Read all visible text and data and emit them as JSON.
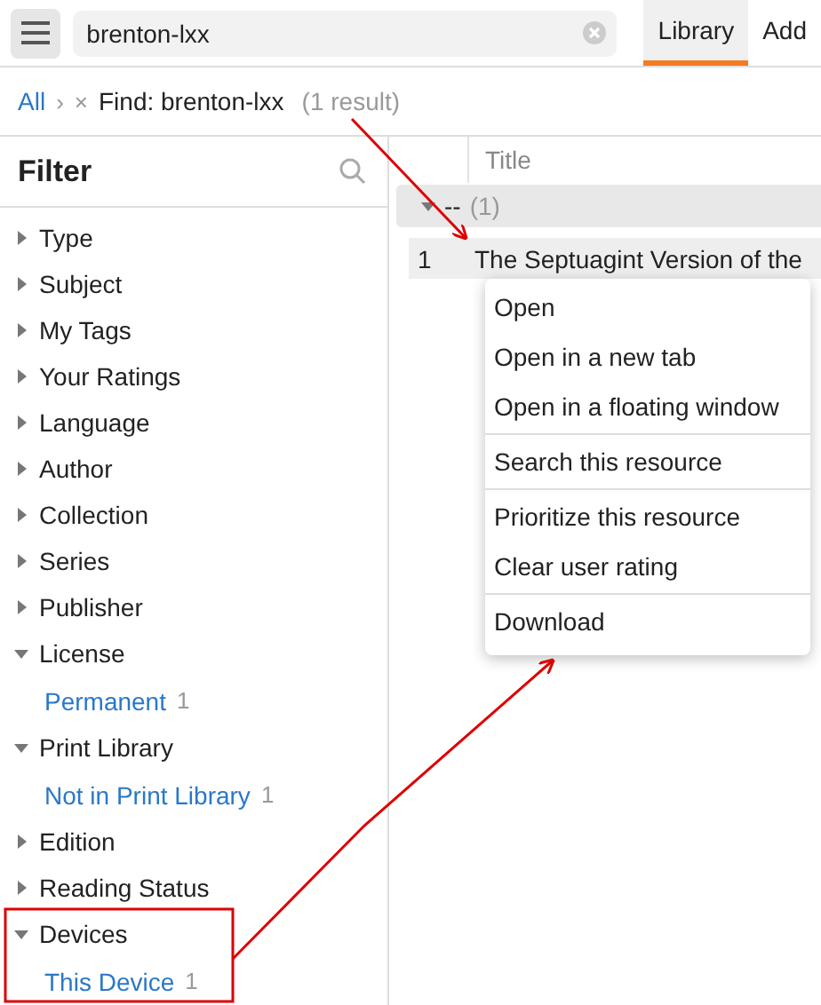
{
  "search": {
    "value": "brenton-lxx"
  },
  "tabs": [
    {
      "label": "Library",
      "selected": true
    },
    {
      "label": "Add",
      "selected": false
    }
  ],
  "breadcrumb": {
    "root": "All",
    "separator": "›",
    "remove": "×",
    "query": "Find: brenton-lxx",
    "count": "(1 result)"
  },
  "filter": {
    "title": "Filter",
    "groups": [
      {
        "label": "Type",
        "expanded": false
      },
      {
        "label": "Subject",
        "expanded": false
      },
      {
        "label": "My Tags",
        "expanded": false
      },
      {
        "label": "Your Ratings",
        "expanded": false
      },
      {
        "label": "Language",
        "expanded": false
      },
      {
        "label": "Author",
        "expanded": false
      },
      {
        "label": "Collection",
        "expanded": false
      },
      {
        "label": "Series",
        "expanded": false
      },
      {
        "label": "Publisher",
        "expanded": false
      },
      {
        "label": "License",
        "expanded": true,
        "children": [
          {
            "label": "Permanent",
            "count": "1"
          }
        ]
      },
      {
        "label": "Print Library",
        "expanded": true,
        "children": [
          {
            "label": "Not in Print Library",
            "count": "1"
          }
        ]
      },
      {
        "label": "Edition",
        "expanded": false
      },
      {
        "label": "Reading Status",
        "expanded": false
      },
      {
        "label": "Devices",
        "expanded": true,
        "children": [
          {
            "label": "This Device",
            "count": "1"
          }
        ]
      }
    ]
  },
  "table": {
    "columns": [
      "Title"
    ],
    "group": {
      "label": "--",
      "count": "(1)",
      "expanded": true
    },
    "rows": [
      {
        "number": "1",
        "title": "The Septuagint Version of the"
      }
    ]
  },
  "context_menu": {
    "sections": [
      [
        "Open",
        "Open in a new tab",
        "Open in a floating window"
      ],
      [
        "Search this resource"
      ],
      [
        "Prioritize this resource",
        "Clear user rating"
      ],
      [
        "Download"
      ]
    ]
  }
}
